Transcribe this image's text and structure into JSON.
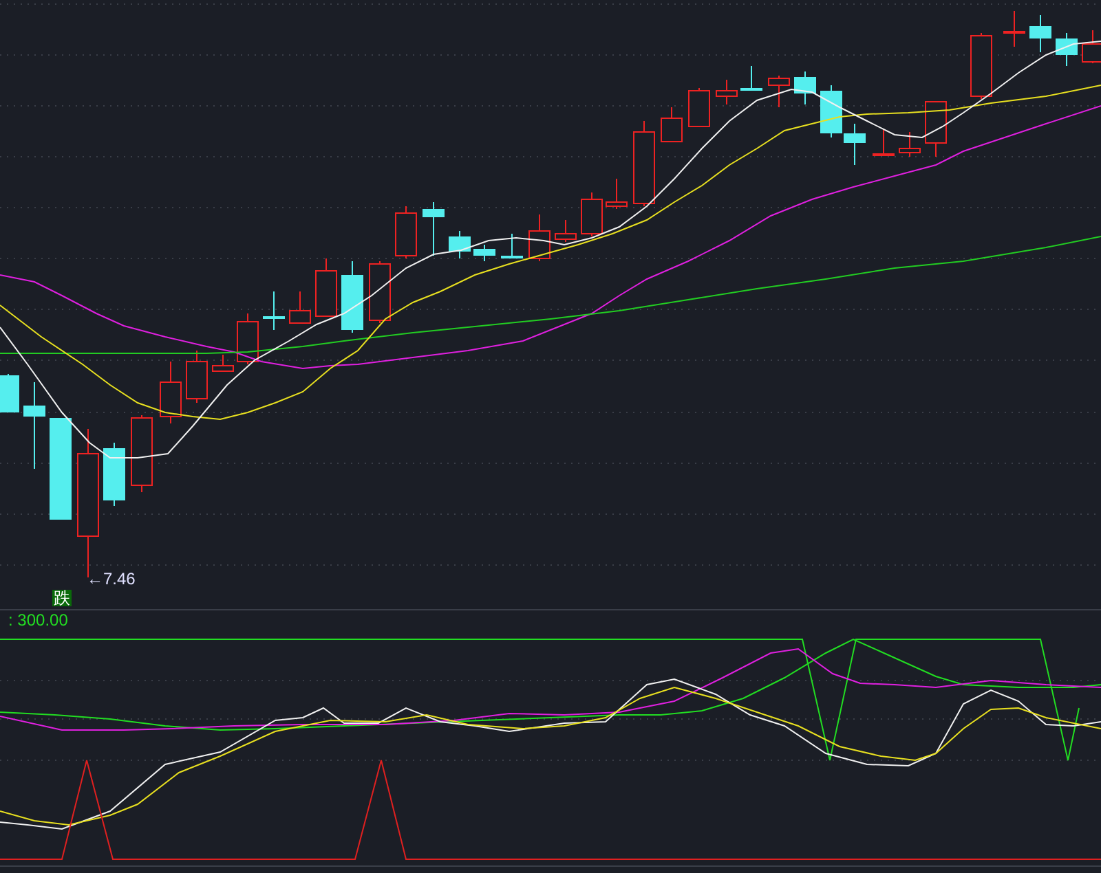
{
  "price_chart": {
    "low_marker": "←7.46",
    "signal_badge": "跌"
  },
  "indicator_panel": {
    "value_label": ": 300.00"
  }
}
